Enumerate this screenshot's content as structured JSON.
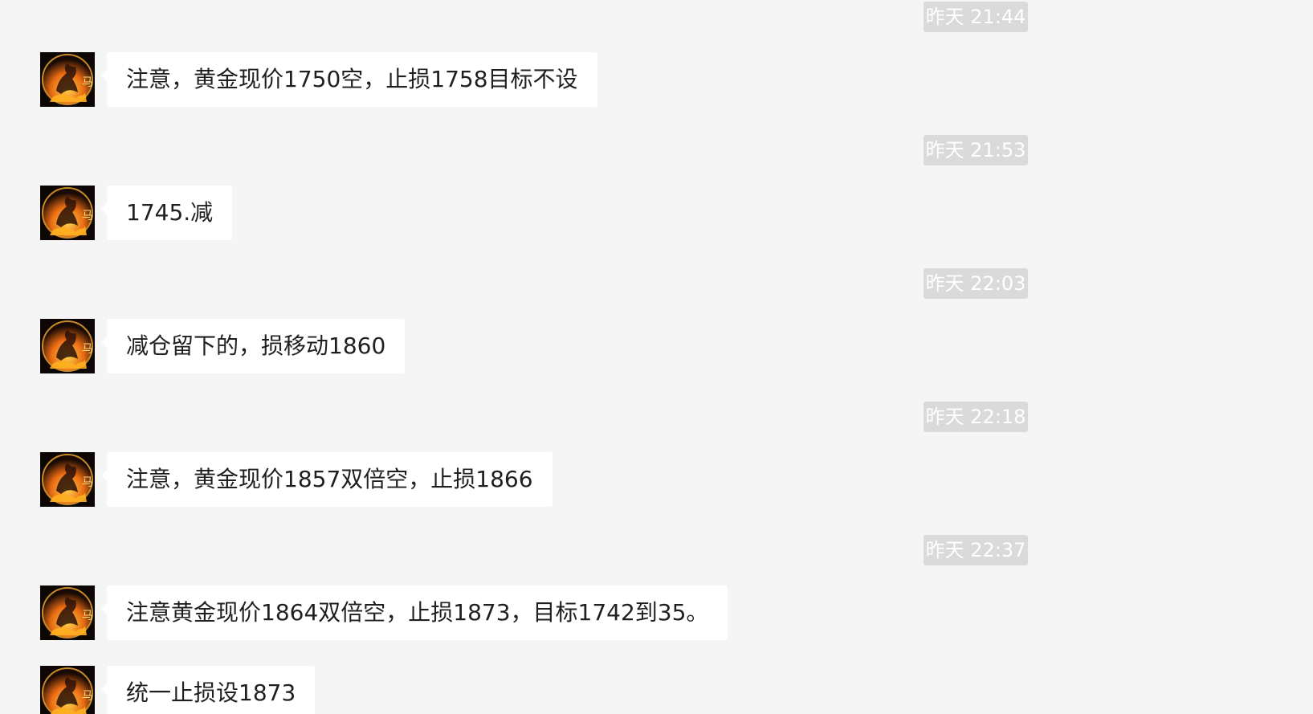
{
  "chat": {
    "messages": [
      {
        "time": "昨天 21:44",
        "text": "注意，黄金现价1750空，止损1758目标不设"
      },
      {
        "time": "昨天 21:53",
        "text": "1745.减"
      },
      {
        "time": "昨天 22:03",
        "text": "减仓留下的，损移动1860"
      },
      {
        "time": "昨天 22:18",
        "text": "注意，黄金现价1857双倍空，止损1866"
      },
      {
        "time": "昨天 22:37",
        "text": "注意黄金现价1864双倍空，止损1873，目标1742到35。"
      },
      {
        "time": "",
        "text": "统一止损设1873"
      }
    ],
    "avatar_icon": "horse-flame-avatar-icon",
    "avatar_glyph": "马"
  }
}
